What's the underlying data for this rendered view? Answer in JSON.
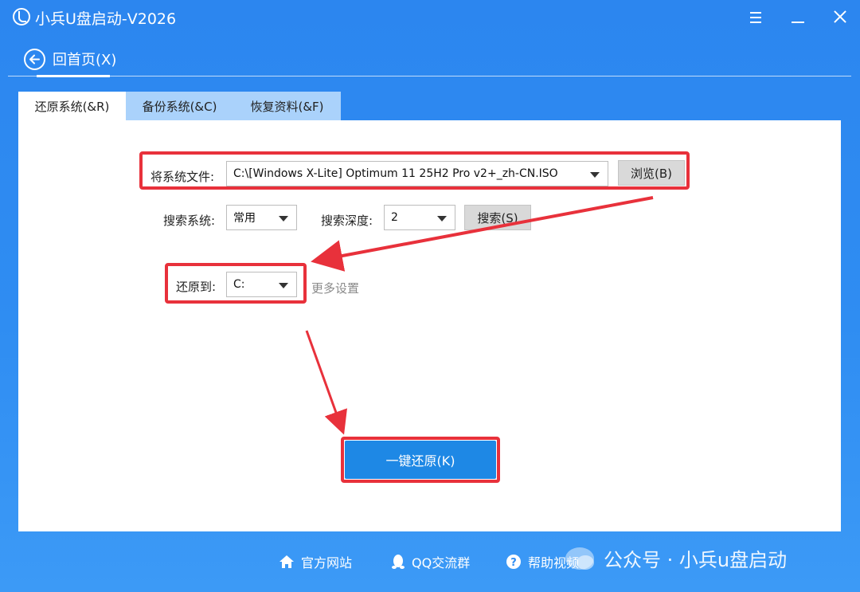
{
  "window": {
    "title": "小兵U盘启动-V2026"
  },
  "nav": {
    "back_label": "回首页(X)"
  },
  "tabs": [
    {
      "label": "还原系统(&R)",
      "active": true
    },
    {
      "label": "备份系统(&C)",
      "active": false
    },
    {
      "label": "恢复资料(&F)",
      "active": false
    }
  ],
  "restore": {
    "system_file_label": "将系统文件:",
    "system_file_value": "C:\\[Windows X-Lite] Optimum 11 25H2 Pro v2+_zh-CN.ISO",
    "browse_label": "浏览(B)",
    "search_system_label": "搜索系统:",
    "search_system_value": "常用",
    "search_depth_label": "搜索深度:",
    "search_depth_value": "2",
    "search_button": "搜索(S)",
    "restore_to_label": "还原到:",
    "restore_to_value": "C:",
    "more_settings": "更多设置",
    "one_click_restore": "一键还原(K)"
  },
  "footer": {
    "official_site": "官方网站",
    "qq_group": "QQ交流群",
    "help_video": "帮助视频",
    "watermark": "公众号 · 小兵u盘启动"
  },
  "colors": {
    "background": "#2f8df2",
    "primary_button": "#1e88e5",
    "annotation_red": "#e8313b",
    "inactive_tab": "#aad2fb"
  }
}
